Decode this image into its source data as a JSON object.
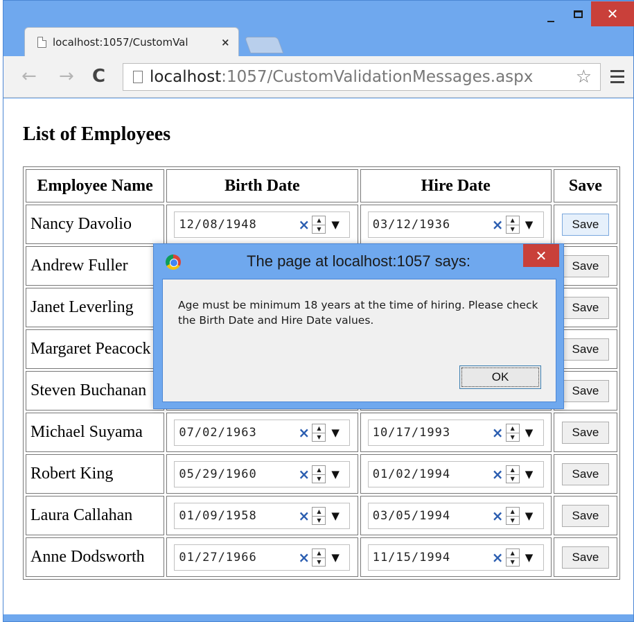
{
  "browser": {
    "tab_title": "localhost:1057/CustomVal",
    "tab_close": "×",
    "url_host": "localhost",
    "url_rest": ":1057/CustomValidationMessages.aspx",
    "nav_back": "←",
    "nav_forward": "→",
    "nav_reload": "C",
    "star": "☆",
    "window_minimize": "_",
    "window_close": "✕"
  },
  "page": {
    "heading": "List of Employees",
    "table": {
      "headers": [
        "Employee Name",
        "Birth Date",
        "Hire Date",
        "Save"
      ],
      "rows": [
        {
          "name": "Nancy Davolio",
          "birth": "12/08/1948",
          "hire": "03/12/1936",
          "save": "Save"
        },
        {
          "name": "Andrew Fuller",
          "birth": "",
          "hire": "",
          "save": "Save"
        },
        {
          "name": "Janet Leverling",
          "birth": "",
          "hire": "",
          "save": "Save"
        },
        {
          "name": "Margaret Peacock",
          "birth": "",
          "hire": "",
          "save": "Save"
        },
        {
          "name": "Steven Buchanan",
          "birth": "",
          "hire": "",
          "save": "Save"
        },
        {
          "name": "Michael Suyama",
          "birth": "07/02/1963",
          "hire": "10/17/1993",
          "save": "Save"
        },
        {
          "name": "Robert King",
          "birth": "05/29/1960",
          "hire": "01/02/1994",
          "save": "Save"
        },
        {
          "name": "Laura Callahan",
          "birth": "01/09/1958",
          "hire": "03/05/1994",
          "save": "Save"
        },
        {
          "name": "Anne Dodsworth",
          "birth": "01/27/1966",
          "hire": "11/15/1994",
          "save": "Save"
        }
      ]
    }
  },
  "dialog": {
    "title": "The page at localhost:1057 says:",
    "close": "✕",
    "message": "Age must be minimum 18 years at the time of hiring. Please check the Birth Date and Hire Date values.",
    "ok_label": "OK"
  },
  "icons": {
    "clear": "×",
    "spin_up": "▲",
    "spin_down": "▼",
    "dropdown": "▼"
  },
  "colors": {
    "window_frame": "#6fa8ee",
    "close_red": "#c9403a",
    "clear_blue": "#2a5db0"
  }
}
